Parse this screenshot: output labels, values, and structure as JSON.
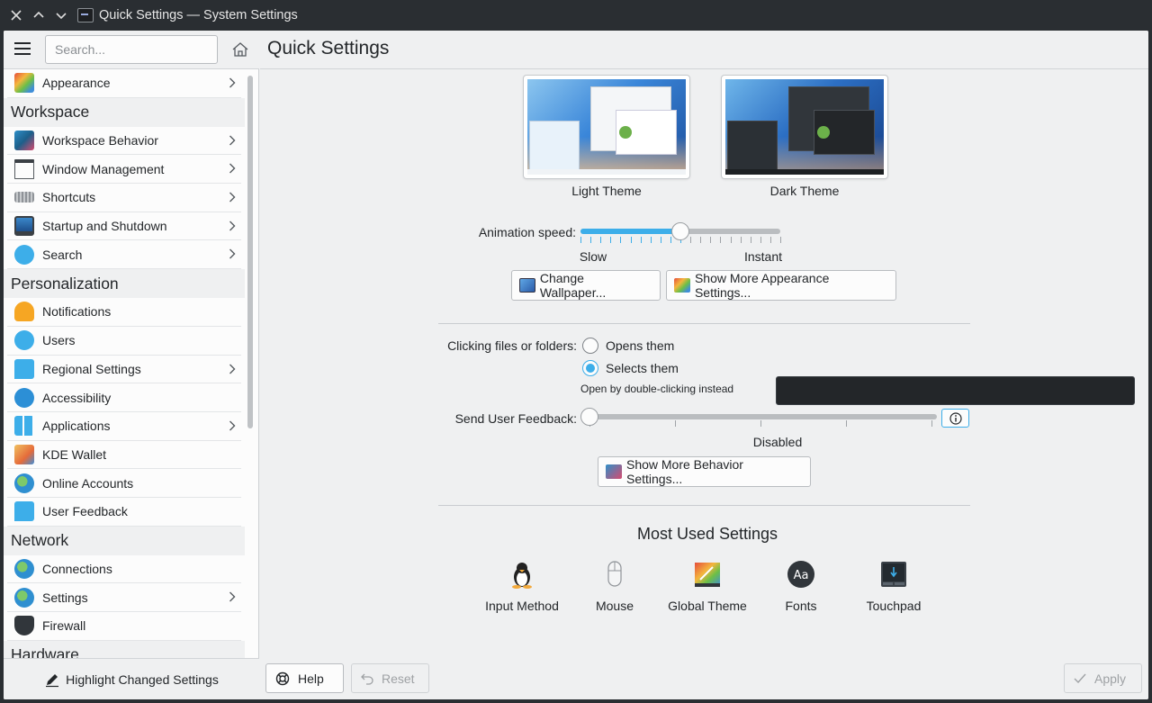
{
  "window": {
    "title": "Quick Settings — System Settings"
  },
  "sidebar": {
    "search_placeholder": "Search...",
    "items": [
      {
        "type": "item",
        "label": "Appearance",
        "icon": "appearance-icon",
        "chevron": true
      },
      {
        "type": "header",
        "label": "Workspace"
      },
      {
        "type": "item",
        "label": "Workspace Behavior",
        "icon": "workspace-behavior-icon",
        "chevron": true
      },
      {
        "type": "item",
        "label": "Window Management",
        "icon": "window-management-icon",
        "chevron": true
      },
      {
        "type": "item",
        "label": "Shortcuts",
        "icon": "keyboard-icon",
        "chevron": true
      },
      {
        "type": "item",
        "label": "Startup and Shutdown",
        "icon": "monitor-icon",
        "chevron": true
      },
      {
        "type": "item",
        "label": "Search",
        "icon": "search-icon",
        "chevron": true
      },
      {
        "type": "header",
        "label": "Personalization"
      },
      {
        "type": "item",
        "label": "Notifications",
        "icon": "bell-icon",
        "chevron": false
      },
      {
        "type": "item",
        "label": "Users",
        "icon": "users-icon",
        "chevron": false
      },
      {
        "type": "item",
        "label": "Regional Settings",
        "icon": "regional-icon",
        "chevron": true
      },
      {
        "type": "item",
        "label": "Accessibility",
        "icon": "accessibility-icon",
        "chevron": false
      },
      {
        "type": "item",
        "label": "Applications",
        "icon": "applications-icon",
        "chevron": true
      },
      {
        "type": "item",
        "label": "KDE Wallet",
        "icon": "wallet-icon",
        "chevron": false
      },
      {
        "type": "item",
        "label": "Online Accounts",
        "icon": "globe-icon",
        "chevron": false
      },
      {
        "type": "item",
        "label": "User Feedback",
        "icon": "feedback-icon",
        "chevron": false
      },
      {
        "type": "header",
        "label": "Network"
      },
      {
        "type": "item",
        "label": "Connections",
        "icon": "globe-icon",
        "chevron": false
      },
      {
        "type": "item",
        "label": "Settings",
        "icon": "globe-icon",
        "chevron": true
      },
      {
        "type": "item",
        "label": "Firewall",
        "icon": "firewall-icon",
        "chevron": false
      },
      {
        "type": "header",
        "label": "Hardware"
      }
    ],
    "highlight_label": "Highlight Changed Settings"
  },
  "main": {
    "title": "Quick Settings",
    "themes": [
      {
        "label": "Light Theme"
      },
      {
        "label": "Dark Theme"
      }
    ],
    "animation": {
      "label": "Animation speed:",
      "min_label": "Slow",
      "max_label": "Instant",
      "value_fraction": 0.5
    },
    "change_wallpaper": "Change Wallpaper...",
    "more_appearance": "Show More Appearance Settings...",
    "clicking": {
      "label": "Clicking files or folders:",
      "opt_open": "Opens them",
      "opt_select": "Selects them",
      "hint": "Open by double-clicking instead",
      "selected": "Selects them"
    },
    "feedback": {
      "label": "Send User Feedback:",
      "value_label": "Disabled",
      "value_fraction": 0
    },
    "more_behavior": "Show More Behavior Settings...",
    "most_used": {
      "title": "Most Used Settings",
      "items": [
        "Input Method",
        "Mouse",
        "Global Theme",
        "Fonts",
        "Touchpad"
      ]
    }
  },
  "footer": {
    "help": "Help",
    "reset": "Reset",
    "apply": "Apply"
  },
  "colors": {
    "accent": "#3daee9",
    "titlebar": "#2a2e32",
    "background": "#eff0f1"
  }
}
